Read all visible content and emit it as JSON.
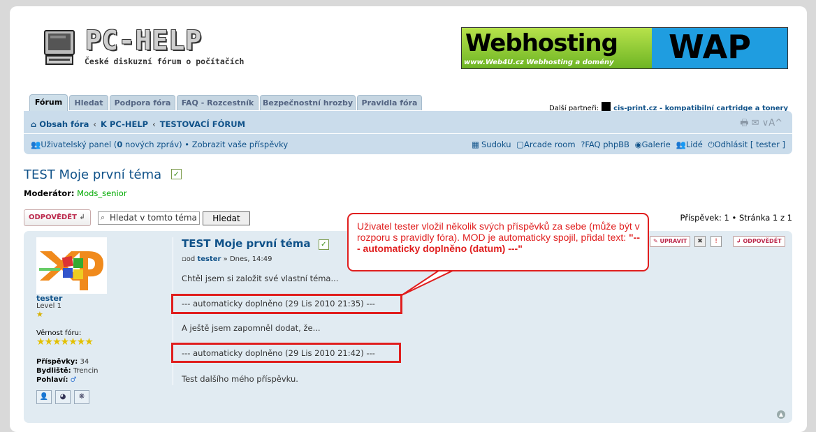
{
  "site": {
    "logo_title": "PC-HELP",
    "logo_subtitle": "České diskuzní fórum o počítačích"
  },
  "banner": {
    "left_text": "Webhosting",
    "right_text": "WAP",
    "sub_text": "www.Web4U.cz  Webhosting a domény"
  },
  "tabs": [
    "Fórum",
    "Hledat",
    "Podpora fóra",
    "FAQ - Rozcestník",
    "Bezpečnostní hrozby",
    "Pravidla fóra"
  ],
  "partners": {
    "label": "Další partneři:",
    "link": "cis-print.cz - kompatibilní cartridge a tonery"
  },
  "breadcrumbs": [
    "Obsah fóra",
    "K PC-HELP",
    "TESTOVACÍ FÓRUM"
  ],
  "navbar": {
    "user_panel": "Uživatelský panel (",
    "new_count": "0",
    "new_msgs": " nových zpráv)",
    "bullet": "•",
    "show_posts": "Zobrazit vaše příspěvky",
    "right_links": [
      "Sudoku",
      "Arcade room",
      "FAQ phpBB",
      "Galerie",
      "Lidé",
      "Odhlásit [ tester ]"
    ],
    "tools": "🖶  ✉  ∨A^"
  },
  "topic": {
    "title": "TEST Moje první téma",
    "moderator_label": "Moderátor:",
    "moderator_name": "Mods_senior"
  },
  "actions": {
    "reply": "ODPOVĚDĚT",
    "search_placeholder": "Hledat v tomto tématu…",
    "search_value": "Hledat v tomto téma",
    "search_button": "Hledat",
    "pagination": "Příspěvek: 1 • Stránka 1 z 1"
  },
  "post": {
    "username": "tester",
    "level": "Level 1",
    "vernost_label": "Věrnost fóru:",
    "posts_label": "Příspěvky:",
    "posts_value": "34",
    "location_label": "Bydliště:",
    "location_value": "Trencin",
    "gender_label": "Pohlaví:",
    "title": "TEST Moje první téma",
    "author_prefix": "od",
    "author": "tester",
    "date": "» Dnes, 14:49",
    "lines": [
      "Chtěl jsem si založit své vlastní téma...",
      "--- automaticky doplněno (29 Lis 2010 21:35) ---",
      "A ještě jsem zapomněl dodat, že...",
      "--- automaticky doplněno (29 Lis 2010 21:42) ---",
      "Test dalšího mého příspěvku."
    ],
    "btn_edit": "UPRAVIT",
    "btn_reply": "ODPOVĚDĚT"
  },
  "annotation": {
    "text": "Uživatel tester vložil několik svých příspěvků za sebe (může být v rozporu s pravidly fóra). MOD je automaticky spojil, přidal text: ",
    "quote": "\"--- automaticky doplněno (datum) ---\""
  }
}
